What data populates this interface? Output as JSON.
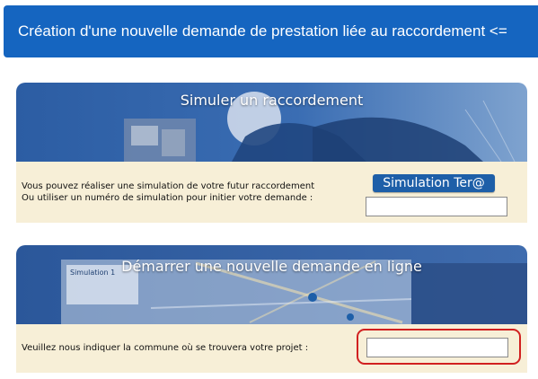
{
  "header": {
    "title": "Création d'une nouvelle demande de prestation liée au raccordement <="
  },
  "simulation_panel": {
    "title": "Simuler un raccordement",
    "line1": "Vous pouvez réaliser une simulation de votre futur raccordement",
    "line2": "Ou utiliser un numéro de simulation pour initier votre demande :",
    "button_label": "Simulation Ter@",
    "input_value": ""
  },
  "new_request_panel": {
    "title": "Démarrer une nouvelle demande en ligne",
    "prompt": "Veuillez nous indiquer la commune où se trouvera votre projet :",
    "input_value": "",
    "screen_text": {
      "heading": "Simulation 1"
    }
  },
  "colors": {
    "header_bg": "#1565c0",
    "button_bg": "#1e5fa8",
    "panel_bg": "#f7efd7",
    "highlight": "#d12020"
  }
}
